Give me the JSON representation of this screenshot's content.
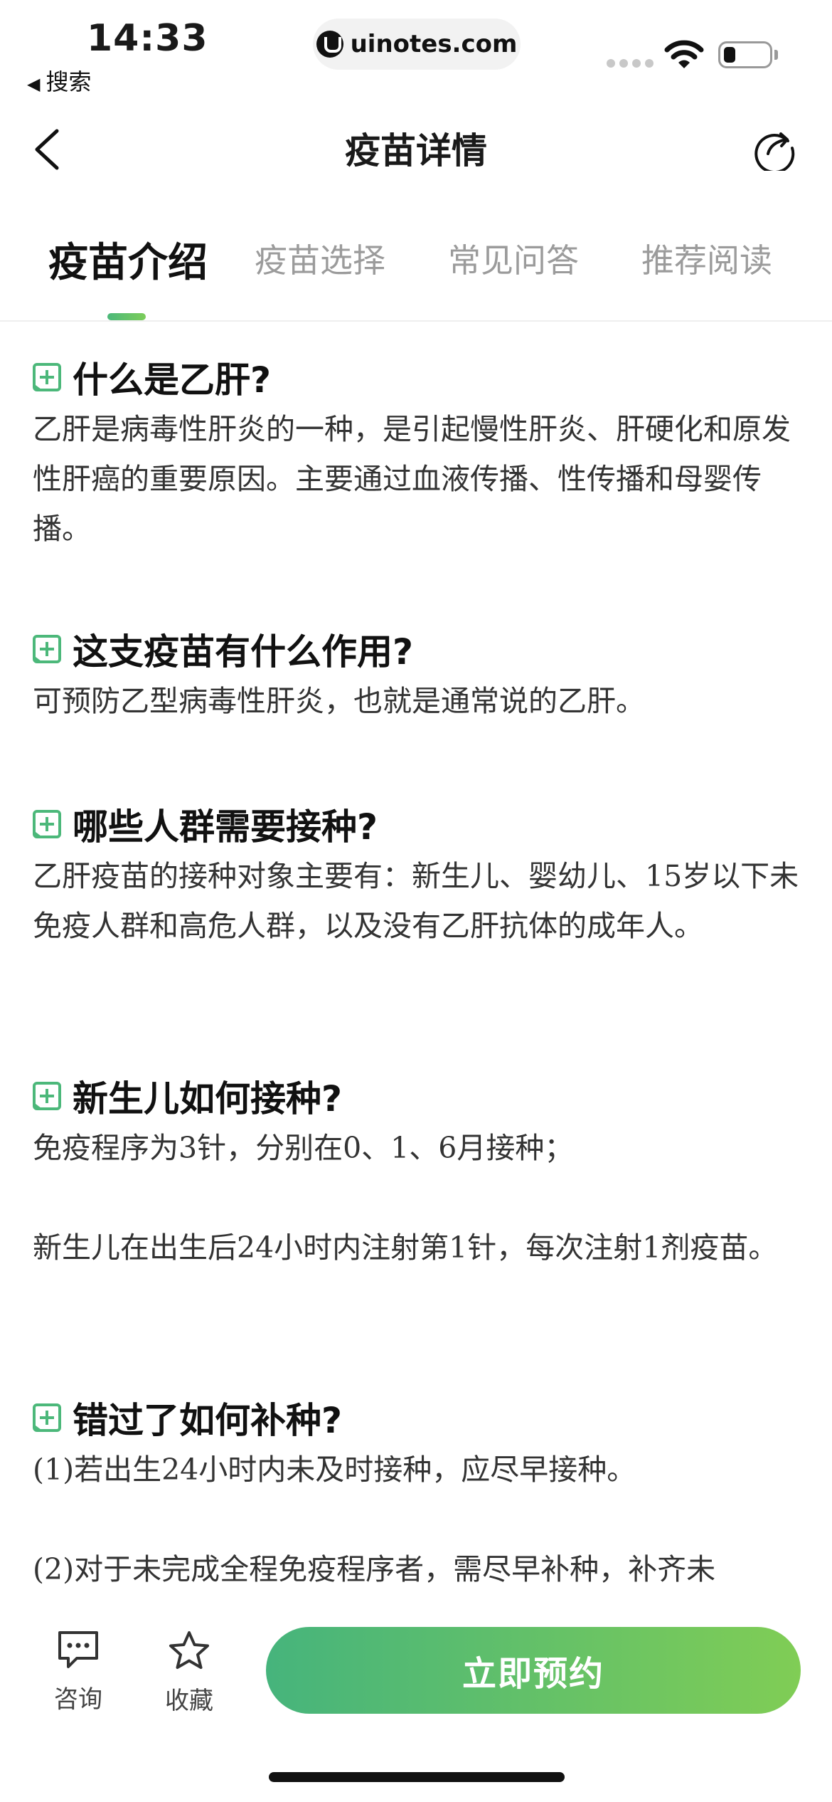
{
  "status_bar": {
    "time": "14:33",
    "back_app_label": "搜索",
    "url": "uinotes.com",
    "battery_level": 0.25
  },
  "nav": {
    "title": "疫苗详情"
  },
  "tabs": [
    {
      "label": "疫苗介绍",
      "active": true
    },
    {
      "label": "疫苗选择",
      "active": false
    },
    {
      "label": "常见问答",
      "active": false
    },
    {
      "label": "推荐阅读",
      "active": false
    }
  ],
  "sections": [
    {
      "title": "什么是乙肝?",
      "paragraphs": [
        "乙肝是病毒性肝炎的一种，是引起慢性肝炎、肝硬化和原发性肝癌的重要原因。主要通过血液传播、性传播和母婴传播。"
      ]
    },
    {
      "title": "这支疫苗有什么作用?",
      "paragraphs": [
        "可预防乙型病毒性肝炎，也就是通常说的乙肝。"
      ]
    },
    {
      "title": "哪些人群需要接种?",
      "paragraphs": [
        "乙肝疫苗的接种对象主要有：新生儿、婴幼儿、15岁以下未免疫人群和高危人群，以及没有乙肝抗体的成年人。"
      ]
    },
    {
      "title": "新生儿如何接种?",
      "paragraphs": [
        "免疫程序为3针，分别在0、1、6月接种；",
        "新生儿在出生后24小时内注射第1针，每次注射1剂疫苗。"
      ]
    },
    {
      "title": "错过了如何补种?",
      "paragraphs": [
        "(1)若出生24小时内未及时接种，应尽早接种。",
        "(2)对于未完成全程免疫程序者，需尽早补种，补齐未"
      ]
    }
  ],
  "bottom_bar": {
    "consult_label": "咨询",
    "favorite_label": "收藏",
    "cta_label": "立即预约"
  },
  "colors": {
    "accent_start": "#46b47c",
    "accent_end": "#80cd55",
    "icon_green": "#4cb87a"
  }
}
